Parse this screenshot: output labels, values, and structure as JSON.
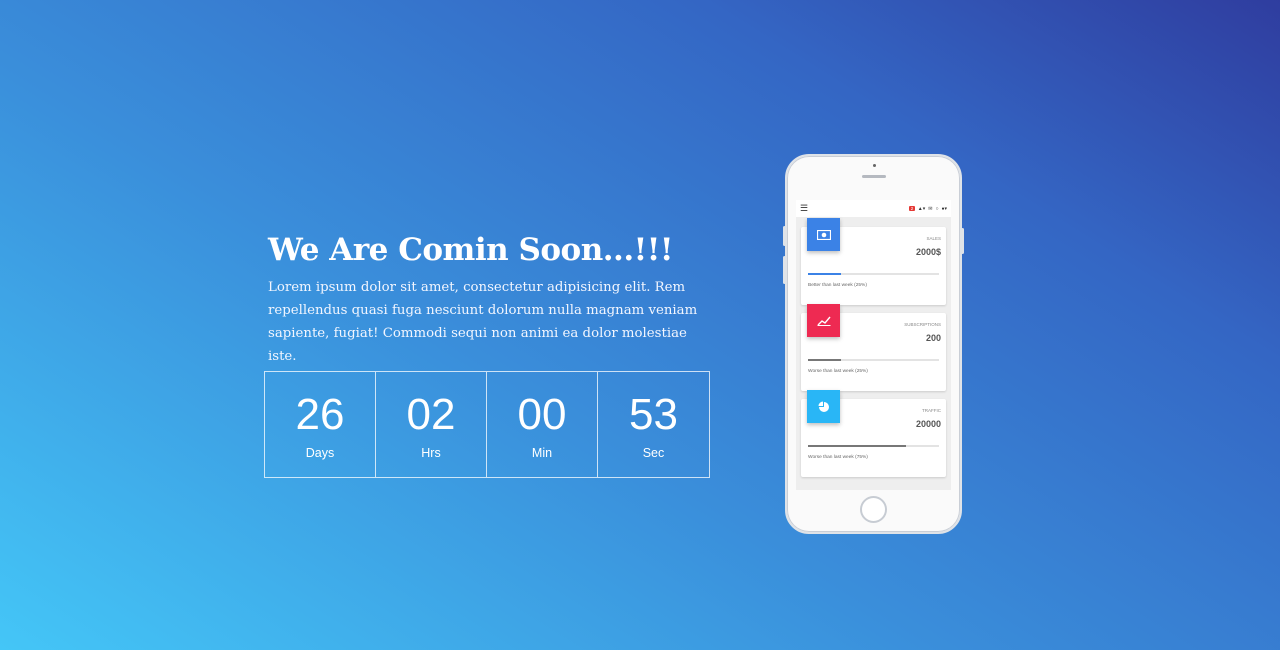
{
  "hero": {
    "title": "We Are Comin Soon...!!!",
    "description": "Lorem ipsum dolor sit amet, consectetur adipisicing elit. Rem repellendus quasi fuga nesciunt dolorum nulla magnam veniam sapiente, fugiat! Commodi sequi non animi ea dolor molestiae iste."
  },
  "countdown": [
    {
      "value": "26",
      "label": "Days"
    },
    {
      "value": "02",
      "label": "Hrs"
    },
    {
      "value": "00",
      "label": "Min"
    },
    {
      "value": "53",
      "label": "Sec"
    }
  ],
  "phone_screen": {
    "topbar": {
      "menu_icon": "hamburger-icon",
      "badge": "2"
    },
    "cards": [
      {
        "category": "SALES",
        "value": "2000$",
        "note": "Better than last week (25%)",
        "icon": "money-icon",
        "color": "#3b82e6",
        "bar_color": "#3b82e6",
        "progress": 0.25
      },
      {
        "category": "SUBSCRIPTIONS",
        "value": "200",
        "note": "Worse than last week (25%)",
        "icon": "chart-line-icon",
        "color": "#ee2a52",
        "bar_color": "#777777",
        "progress": 0.25
      },
      {
        "category": "TRAFFIC",
        "value": "20000",
        "note": "Worse than last week (75%)",
        "icon": "pie-chart-icon",
        "color": "#29b6f6",
        "bar_color": "#777777",
        "progress": 0.75
      }
    ]
  }
}
